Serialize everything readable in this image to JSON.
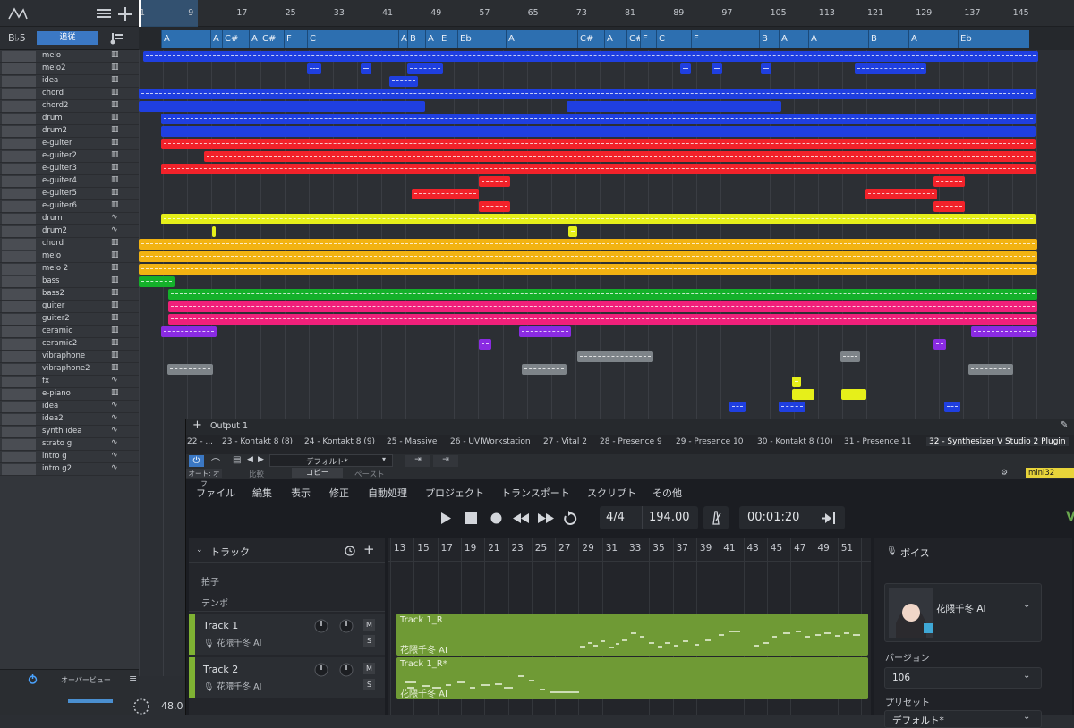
{
  "app": {
    "logo_icon": "studio-one-logo-icon",
    "list_icon": "list-view-icon",
    "add_icon": "plus-icon"
  },
  "key": {
    "root": "B♭5",
    "mode": "追従"
  },
  "tracks": [
    {
      "name": "melo",
      "icon": "piano-icon"
    },
    {
      "name": "melo2",
      "icon": "piano-icon"
    },
    {
      "name": "idea",
      "icon": "piano-icon"
    },
    {
      "name": "chord",
      "icon": "piano-icon"
    },
    {
      "name": "chord2",
      "icon": "piano-icon"
    },
    {
      "name": "drum",
      "icon": "piano-icon"
    },
    {
      "name": "drum2",
      "icon": "piano-icon"
    },
    {
      "name": "e-guiter",
      "icon": "piano-icon"
    },
    {
      "name": "e-guiter2",
      "icon": "piano-icon"
    },
    {
      "name": "e-guiter3",
      "icon": "piano-icon"
    },
    {
      "name": "e-guiter4",
      "icon": "piano-icon"
    },
    {
      "name": "e-guiter5",
      "icon": "piano-icon"
    },
    {
      "name": "e-guiter6",
      "icon": "piano-icon"
    },
    {
      "name": "drum",
      "icon": "waveform-icon"
    },
    {
      "name": "drum2",
      "icon": "waveform-icon"
    },
    {
      "name": "chord",
      "icon": "piano-icon"
    },
    {
      "name": "melo",
      "icon": "piano-icon"
    },
    {
      "name": "melo 2",
      "icon": "piano-icon"
    },
    {
      "name": "bass",
      "icon": "piano-icon"
    },
    {
      "name": "bass2",
      "icon": "piano-icon"
    },
    {
      "name": "guiter",
      "icon": "piano-icon"
    },
    {
      "name": "guiter2",
      "icon": "piano-icon"
    },
    {
      "name": "ceramic",
      "icon": "piano-icon"
    },
    {
      "name": "ceramic2",
      "icon": "piano-icon"
    },
    {
      "name": "vibraphone",
      "icon": "piano-icon"
    },
    {
      "name": "vibraphone2",
      "icon": "piano-icon"
    },
    {
      "name": "fx",
      "icon": "waveform-icon"
    },
    {
      "name": "e-piano",
      "icon": "piano-icon"
    },
    {
      "name": "idea",
      "icon": "waveform-icon"
    },
    {
      "name": "idea2",
      "icon": "waveform-icon"
    },
    {
      "name": "synth idea",
      "icon": "waveform-icon"
    },
    {
      "name": "strato g",
      "icon": "waveform-icon"
    },
    {
      "name": "intro g",
      "icon": "waveform-icon"
    },
    {
      "name": "intro g2",
      "icon": "waveform-icon"
    }
  ],
  "ruler": [
    "1",
    "9",
    "17",
    "25",
    "33",
    "41",
    "49",
    "57",
    "65",
    "73",
    "81",
    "89",
    "97",
    "105",
    "113",
    "121",
    "129",
    "137",
    "145"
  ],
  "chords": [
    "A",
    "A",
    "C#",
    "A",
    "C#",
    "F",
    "C",
    "A",
    "B",
    "A",
    "E",
    "Eb",
    "A",
    "C#",
    "A",
    "C#",
    "F",
    "C",
    "F",
    "B",
    "A",
    "A",
    "B",
    "A",
    "Eb"
  ],
  "bottom": {
    "overview": "オーバービュー",
    "cpu": "48.0"
  },
  "plugin": {
    "output": "Output 1",
    "tabs": [
      "22 - ...",
      "23 - Kontakt 8 (8)",
      "24 - Kontakt 8 (9)",
      "25 - Massive",
      "26 - UVIWorkstation",
      "27 - Vital 2",
      "28 - Presence 9",
      "29 - Presence 10",
      "30 - Kontakt 8 (10)",
      "31 - Presence 11",
      "32 - Synthesizer V Studio 2 Plugin"
    ],
    "preset": "デフォルト*",
    "auto": "オート: オフ",
    "compare": "比較",
    "copy": "コピー",
    "paste": "ペースト",
    "badge": "mini32",
    "menu": [
      "ファイル",
      "編集",
      "表示",
      "修正",
      "自動処理",
      "プロジェクト",
      "トランスポート",
      "スクリプト",
      "その他"
    ],
    "meter": "4/4",
    "tempo": "194.00",
    "time": "00:01:20",
    "track_header": "トラック",
    "sv_ruler": [
      "13",
      "15",
      "17",
      "19",
      "21",
      "23",
      "25",
      "27",
      "29",
      "31",
      "33",
      "35",
      "37",
      "39",
      "41",
      "43",
      "45",
      "47",
      "49",
      "51"
    ],
    "lanes": [
      "拍子",
      "テンポ"
    ],
    "sv_tracks": [
      {
        "name": "Track 1",
        "voice": "花隈千冬 AI",
        "clip": "Track 1_R",
        "clip_voice": "花隈千冬 AI"
      },
      {
        "name": "Track 2",
        "voice": "花隈千冬 AI",
        "clip": "Track 1_R*",
        "clip_voice": "花隈千冬 AI"
      }
    ],
    "voice_panel": {
      "title": "ボイス",
      "voice": "花隈千冬 AI",
      "version_label": "バージョン",
      "version": "106",
      "preset_label": "プリセット",
      "preset": "デフォルト*"
    }
  },
  "colors": {
    "blue": "#1f3fe0",
    "red": "#f2222a",
    "yellow": "#e6ef1a",
    "orange": "#f2b312",
    "green": "#14b02a",
    "pink": "#f0207a",
    "purple": "#8a2be2",
    "gray": "#7e8489",
    "sv_green": "#6f9a35"
  }
}
